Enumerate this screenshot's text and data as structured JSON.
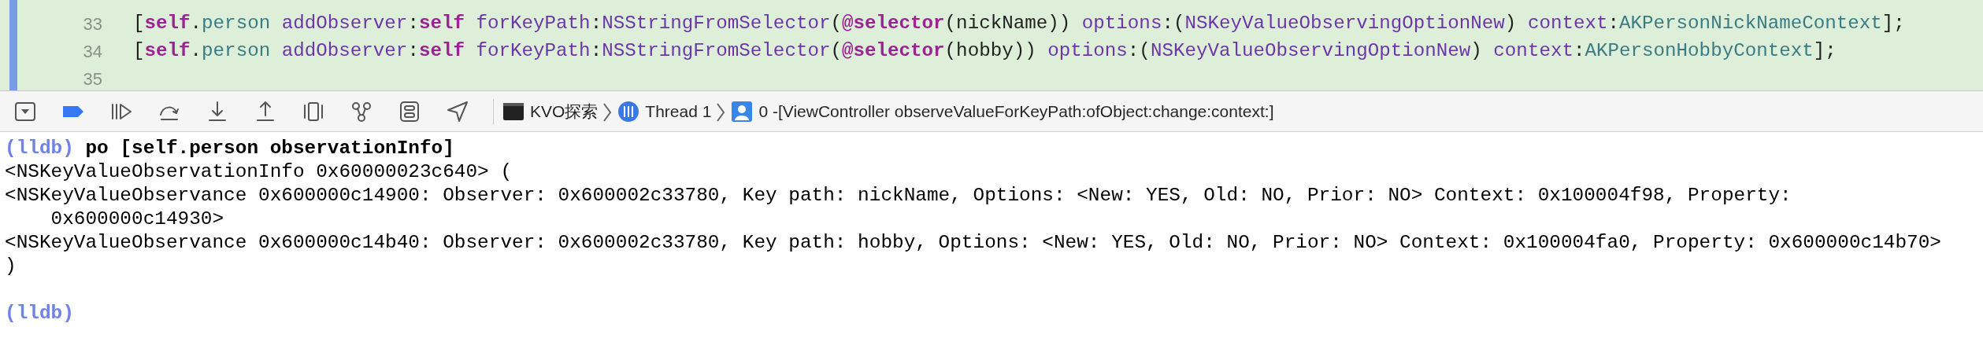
{
  "editor": {
    "lines": [
      {
        "number": "33",
        "tokens": [
          {
            "kind": "plain",
            "text": "["
          },
          {
            "kind": "keyword",
            "text": "self"
          },
          {
            "kind": "plain",
            "text": "."
          },
          {
            "kind": "property",
            "text": "person "
          },
          {
            "kind": "method",
            "text": "addObserver"
          },
          {
            "kind": "plain",
            "text": ":"
          },
          {
            "kind": "keyword",
            "text": "self "
          },
          {
            "kind": "method",
            "text": "forKeyPath"
          },
          {
            "kind": "plain",
            "text": ":"
          },
          {
            "kind": "method",
            "text": "NSStringFromSelector"
          },
          {
            "kind": "plain",
            "text": "("
          },
          {
            "kind": "keyword",
            "text": "@selector"
          },
          {
            "kind": "plain",
            "text": "(nickName)) "
          },
          {
            "kind": "method",
            "text": "options"
          },
          {
            "kind": "plain",
            "text": ":("
          },
          {
            "kind": "method",
            "text": "NSKeyValueObservingOptionNew"
          },
          {
            "kind": "plain",
            "text": ") "
          },
          {
            "kind": "method",
            "text": "context"
          },
          {
            "kind": "plain",
            "text": ":"
          },
          {
            "kind": "constant",
            "text": "AKPersonNickNameContext"
          },
          {
            "kind": "plain",
            "text": "];"
          }
        ]
      },
      {
        "number": "34",
        "tokens": [
          {
            "kind": "plain",
            "text": "["
          },
          {
            "kind": "keyword",
            "text": "self"
          },
          {
            "kind": "plain",
            "text": "."
          },
          {
            "kind": "property",
            "text": "person "
          },
          {
            "kind": "method",
            "text": "addObserver"
          },
          {
            "kind": "plain",
            "text": ":"
          },
          {
            "kind": "keyword",
            "text": "self "
          },
          {
            "kind": "method",
            "text": "forKeyPath"
          },
          {
            "kind": "plain",
            "text": ":"
          },
          {
            "kind": "method",
            "text": "NSStringFromSelector"
          },
          {
            "kind": "plain",
            "text": "("
          },
          {
            "kind": "keyword",
            "text": "@selector"
          },
          {
            "kind": "plain",
            "text": "(hobby)) "
          },
          {
            "kind": "method",
            "text": "options"
          },
          {
            "kind": "plain",
            "text": ":("
          },
          {
            "kind": "method",
            "text": "NSKeyValueObservingOptionNew"
          },
          {
            "kind": "plain",
            "text": ") "
          },
          {
            "kind": "method",
            "text": "context"
          },
          {
            "kind": "plain",
            "text": ":"
          },
          {
            "kind": "constant",
            "text": "AKPersonHobbyContext"
          },
          {
            "kind": "plain",
            "text": "];"
          }
        ]
      },
      {
        "number": "35"
      }
    ]
  },
  "debug_bar": {
    "breakpoints_active": true,
    "breadcrumbs": [
      {
        "kind": "target",
        "label": "KVO探索"
      },
      {
        "kind": "thread",
        "label": "Thread 1"
      },
      {
        "kind": "frame",
        "label": "0 -[ViewController observeValueForKeyPath:ofObject:change:context:]"
      }
    ]
  },
  "console": {
    "lines": [
      {
        "kind": "prompt",
        "prompt": "(lldb)",
        "command": "po [self.person observationInfo]"
      },
      {
        "kind": "output",
        "text": "<NSKeyValueObservationInfo 0x60000023c640> ("
      },
      {
        "kind": "output",
        "text": "<NSKeyValueObservance 0x600000c14900: Observer: 0x600002c33780, Key path: nickName, Options: <New: YES, Old: NO, Prior: NO> Context: 0x100004f98, Property: 0x600000c14930>"
      },
      {
        "kind": "output",
        "text": "<NSKeyValueObservance 0x600000c14b40: Observer: 0x600002c33780, Key path: hobby, Options: <New: YES, Old: NO, Prior: NO> Context: 0x100004fa0, Property: 0x600000c14b70>"
      },
      {
        "kind": "output",
        "text": ")"
      },
      {
        "kind": "blank"
      },
      {
        "kind": "prompt",
        "prompt": "(lldb)"
      }
    ]
  }
}
